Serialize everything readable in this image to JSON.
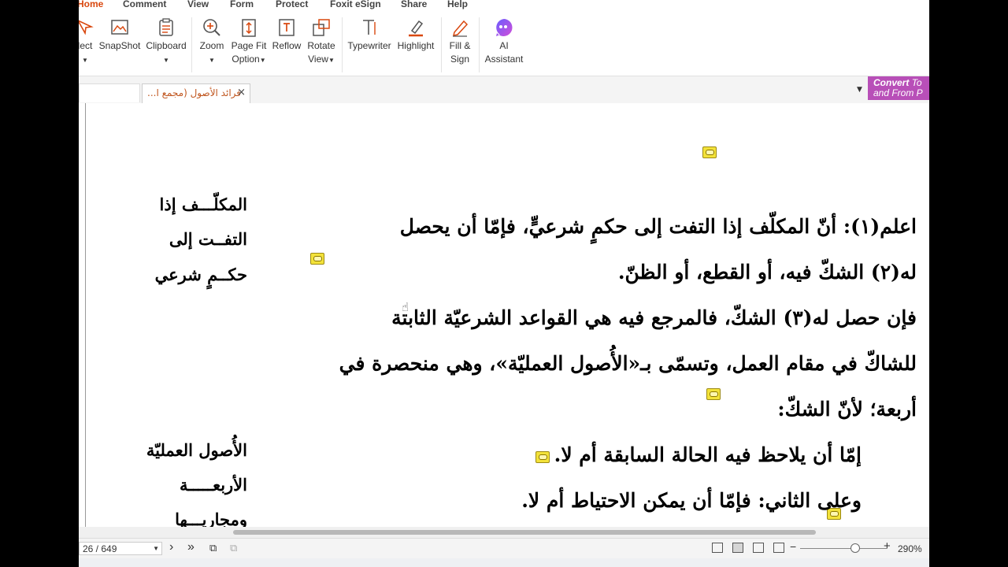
{
  "menu": [
    "Home",
    "Comment",
    "View",
    "Form",
    "Protect",
    "Foxit eSign",
    "Share",
    "Help"
  ],
  "ribbon": {
    "select": "lect",
    "snapshot": "SnapShot",
    "clipboard": "Clipboard",
    "zoom": "Zoom",
    "page_fit_1": "Page Fit",
    "page_fit_2": "Option",
    "reflow": "Reflow",
    "rotate_1": "Rotate",
    "rotate_2": "View",
    "typewriter": "Typewriter",
    "highlight": "Highlight",
    "fill_1": "Fill &",
    "fill_2": "Sign",
    "ai_1": "AI",
    "ai_2": "Assistant"
  },
  "tab": {
    "title": "فرائد الأصول (مجمع ا...",
    "close": "×"
  },
  "convert": {
    "line1": "Convert",
    "line1b": "To",
    "line2": "and From P"
  },
  "doc": {
    "lines": [
      "اعلم(١): أنّ المكلّف إذا التفت إلى حكمٍ شرعيٍّ، فإمّا أن يحصل",
      "له(٢) الشكّ فيه، أو القطع، أو الظنّ.",
      "فإن حصل له(٣) الشكّ، فالمرجع فيه هي القواعد الشرعيّة الثابتة",
      "للشاكّ في مقام العمل، وتسمّى بـ«الأُصول العمليّة»، وهي منحصرة في",
      "أربعة؛ لأنّ الشكّ:",
      "إمّا أن يلاحظ فيه الحالة السابقة أم لا.",
      "وعلى الثاني: فإمّا أن يمكن الاحتياط أم لا."
    ],
    "side1": [
      "المكلّـــف إذا",
      "التفــت إلى",
      "حكــمٍ شرعي"
    ],
    "side2": [
      "الأُصول العمليّة",
      "الأربعـــــة",
      "ومجاريـــها"
    ]
  },
  "status": {
    "page": "26 / 649",
    "zoom": "290%",
    "zoom_level_percent": 290
  },
  "colors": {
    "accent": "#d9480f",
    "convert_bg": "#b84fb8",
    "note": "#f3e23a"
  }
}
